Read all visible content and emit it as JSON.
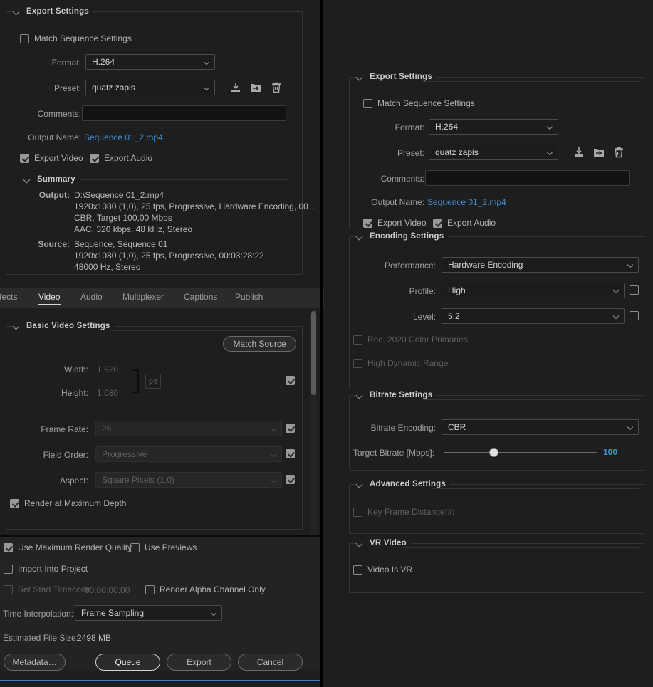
{
  "colors": {
    "accent_link": "#3f8fd2",
    "panel_bg": "#1e1e1e",
    "bottom_bar_bg": "#232323",
    "underline": "#2f7fc1"
  },
  "left_panel": {
    "export_settings": {
      "title": "Export Settings",
      "match_sequence_settings": {
        "label": "Match Sequence Settings",
        "checked": false
      },
      "format": {
        "label": "Format:",
        "value": "H.264"
      },
      "preset": {
        "label": "Preset:",
        "value": "quatz zapis"
      },
      "preset_icons": [
        "save-preset-icon",
        "import-preset-icon",
        "delete-preset-icon"
      ],
      "comments": {
        "label": "Comments:",
        "value": "",
        "placeholder": ""
      },
      "output_name": {
        "label": "Output Name:",
        "value": "Sequence 01_2.mp4"
      },
      "export_video": {
        "label": "Export Video",
        "checked": true
      },
      "export_audio": {
        "label": "Export Audio",
        "checked": true
      }
    },
    "summary": {
      "title": "Summary",
      "output_key": "Output:",
      "output_lines": [
        "D:\\Sequence 01_2.mp4",
        "1920x1080 (1,0), 25 fps, Progressive, Hardware Encoding, 00…",
        "CBR, Target 100,00 Mbps",
        "AAC, 320 kbps, 48 kHz, Stereo"
      ],
      "source_key": "Source:",
      "source_lines": [
        "Sequence, Sequence 01",
        "1920x1080 (1,0), 25 fps, Progressive, 00:03:28:22",
        "48000 Hz, Stereo"
      ]
    },
    "tabs": [
      {
        "label": "ffects",
        "active": false
      },
      {
        "label": "Video",
        "active": true
      },
      {
        "label": "Audio",
        "active": false
      },
      {
        "label": "Multiplexer",
        "active": false
      },
      {
        "label": "Captions",
        "active": false
      },
      {
        "label": "Publish",
        "active": false
      }
    ],
    "basic_video": {
      "title": "Basic Video Settings",
      "match_source": "Match Source",
      "width": {
        "label": "Width:",
        "value": "1 920"
      },
      "height": {
        "label": "Height:",
        "value": "1 080"
      },
      "link_icon": "broken-chain-icon",
      "dimensions_checked": true,
      "frame_rate": {
        "label": "Frame Rate:",
        "value": "25",
        "checked": true
      },
      "field_order": {
        "label": "Field Order:",
        "value": "Progressive",
        "checked": true
      },
      "aspect": {
        "label": "Aspect:",
        "value": "Square Pixels (1.0)",
        "checked": true
      },
      "render_max_depth": {
        "label": "Render at Maximum Depth",
        "checked": true
      }
    },
    "footer": {
      "use_max_render_quality": {
        "label": "Use Maximum Render Quality",
        "checked": true
      },
      "use_previews": {
        "label": "Use Previews",
        "checked": false
      },
      "import_into_project": {
        "label": "Import Into Project",
        "checked": false
      },
      "set_start_timecode": {
        "label": "Set Start Timecode",
        "checked": false,
        "value": "00:00:00:00"
      },
      "render_alpha_only": {
        "label": "Render Alpha Channel Only",
        "checked": false
      },
      "time_interpolation": {
        "label": "Time Interpolation:",
        "value": "Frame Sampling"
      },
      "estimated_file_size": {
        "label": "Estimated File Size:",
        "value": "2498 MB"
      },
      "buttons": {
        "metadata": "Metadata…",
        "queue": "Queue",
        "export": "Export",
        "cancel": "Cancel"
      }
    }
  },
  "right_panel": {
    "export_settings": {
      "title": "Export Settings",
      "match_sequence_settings": {
        "label": "Match Sequence Settings",
        "checked": false
      },
      "format": {
        "label": "Format:",
        "value": "H.264"
      },
      "preset": {
        "label": "Preset:",
        "value": "quatz zapis"
      },
      "comments": {
        "label": "Comments:",
        "value": ""
      },
      "output_name": {
        "label": "Output Name:",
        "value": "Sequence 01_2.mp4"
      },
      "export_video": {
        "label": "Export Video",
        "checked": true
      },
      "export_audio": {
        "label": "Export Audio",
        "checked": true
      }
    },
    "encoding_settings": {
      "title": "Encoding Settings",
      "performance": {
        "label": "Performance:",
        "value": "Hardware Encoding"
      },
      "profile": {
        "label": "Profile:",
        "value": "High",
        "checked": false
      },
      "level": {
        "label": "Level:",
        "value": "5.2",
        "checked": false
      },
      "rec2020": {
        "label": "Rec. 2020 Color Primaries",
        "checked": false
      },
      "hdr": {
        "label": "High Dynamic Range",
        "checked": false
      }
    },
    "bitrate_settings": {
      "title": "Bitrate Settings",
      "bitrate_encoding": {
        "label": "Bitrate Encoding:",
        "value": "CBR"
      },
      "target_bitrate": {
        "label": "Target Bitrate [Mbps]:",
        "value": "100",
        "min": 0,
        "max": 200,
        "knob_pct": 32
      }
    },
    "advanced_settings": {
      "title": "Advanced Settings",
      "key_frame_distance": {
        "label": "Key Frame Distance:",
        "checked": false,
        "value": "90"
      }
    },
    "vr_video": {
      "title": "VR Video",
      "video_is_vr": {
        "label": "Video Is VR",
        "checked": false
      }
    }
  }
}
